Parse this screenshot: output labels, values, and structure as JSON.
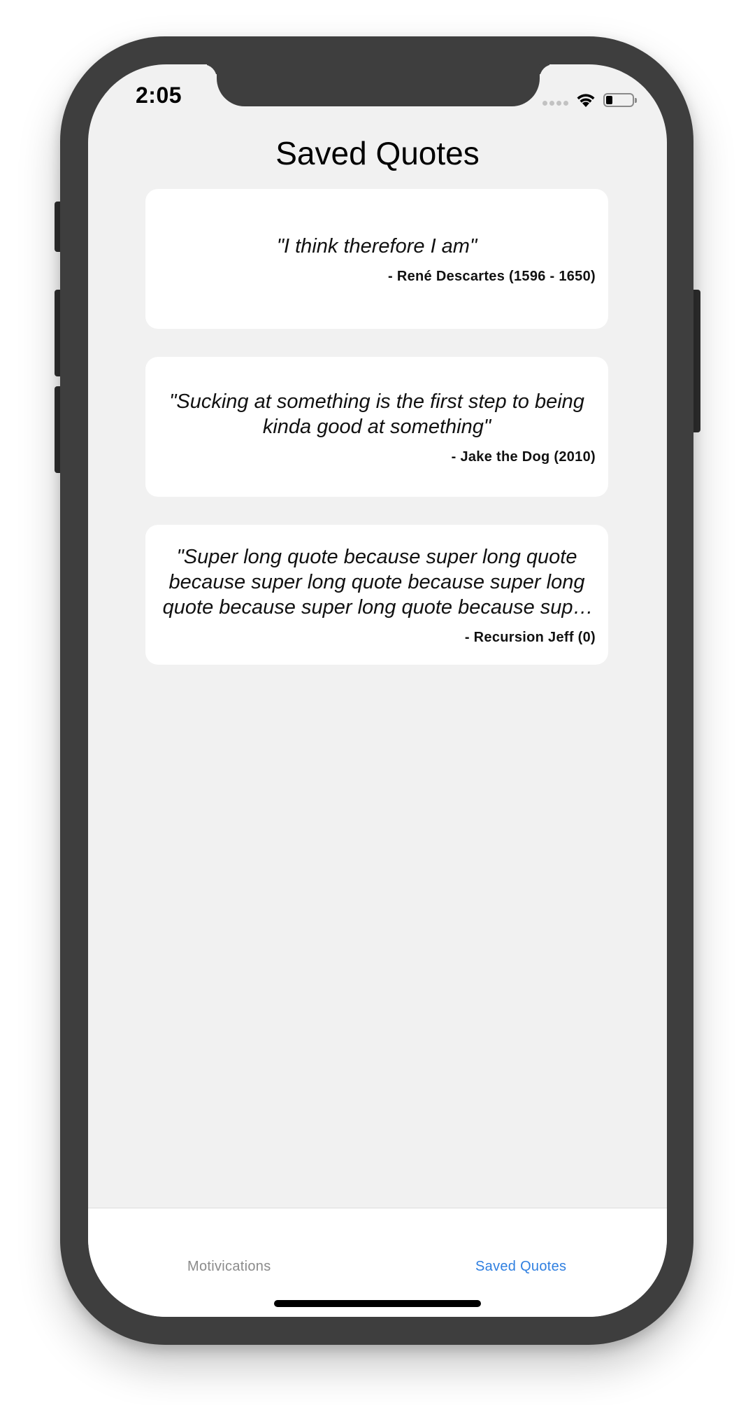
{
  "status_bar": {
    "time": "2:05",
    "battery_level": 0.25
  },
  "page": {
    "title": "Saved Quotes"
  },
  "quotes": [
    {
      "text": "\"I think therefore I am\"",
      "author": "- René Descartes (1596 - 1650)"
    },
    {
      "text": "\"Sucking at something is the first step to being kinda good at something\"",
      "author": "- Jake the Dog (2010)"
    },
    {
      "text": "\"Super long quote because super long quote because super long quote because super long quote because super long quote because super long quote because super long quote\"",
      "author": "- Recursion Jeff (0)"
    }
  ],
  "tab_bar": {
    "tabs": [
      {
        "label": "Motivications",
        "active": false
      },
      {
        "label": "Saved Quotes",
        "active": true
      }
    ],
    "active_color": "#2f7fe0",
    "inactive_color": "#8b8b8b"
  },
  "icons": {
    "wifi": "wifi-icon",
    "signal": "cellular-signal-icon",
    "battery": "battery-icon"
  }
}
